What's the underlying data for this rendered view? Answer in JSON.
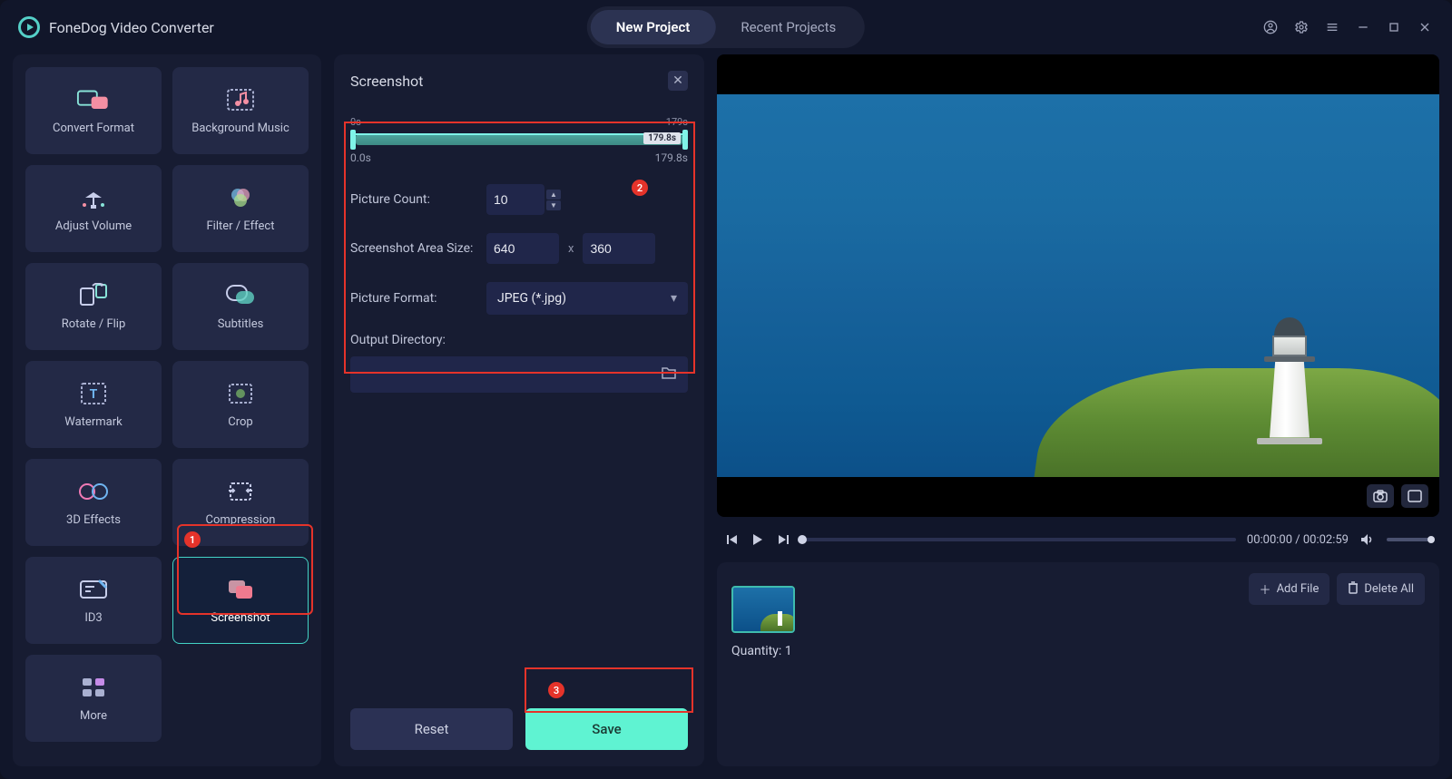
{
  "app": {
    "title": "FoneDog Video Converter"
  },
  "header": {
    "tabs": [
      {
        "label": "New Project",
        "active": true
      },
      {
        "label": "Recent Projects",
        "active": false
      }
    ]
  },
  "sidebar": {
    "tools": [
      {
        "id": "convert-format",
        "label": "Convert Format"
      },
      {
        "id": "background-music",
        "label": "Background Music"
      },
      {
        "id": "adjust-volume",
        "label": "Adjust Volume"
      },
      {
        "id": "filter-effect",
        "label": "Filter / Effect"
      },
      {
        "id": "rotate-flip",
        "label": "Rotate / Flip"
      },
      {
        "id": "subtitles",
        "label": "Subtitles"
      },
      {
        "id": "watermark",
        "label": "Watermark"
      },
      {
        "id": "crop",
        "label": "Crop"
      },
      {
        "id": "3d-effects",
        "label": "3D Effects"
      },
      {
        "id": "compression",
        "label": "Compression"
      },
      {
        "id": "id3",
        "label": "ID3"
      },
      {
        "id": "screenshot",
        "label": "Screenshot",
        "selected": true
      },
      {
        "id": "more",
        "label": "More"
      }
    ]
  },
  "settings": {
    "title": "Screenshot",
    "timeline": {
      "start_label": "0s",
      "end_label": "179s",
      "under_start": "0.0s",
      "under_end": "179.8s",
      "badge": "179.8s"
    },
    "picture_count": {
      "label": "Picture Count:",
      "value": "10"
    },
    "area_size": {
      "label": "Screenshot Area Size:",
      "width": "640",
      "height": "360",
      "multiply": "x"
    },
    "picture_format": {
      "label": "Picture Format:",
      "value": "JPEG (*.jpg)"
    },
    "output_dir": {
      "label": "Output Directory:",
      "value": ""
    },
    "buttons": {
      "reset": "Reset",
      "save": "Save"
    }
  },
  "preview": {
    "time": "00:00:00 / 00:02:59"
  },
  "assets": {
    "add_file": "Add File",
    "delete_all": "Delete All",
    "quantity_label": "Quantity: 1"
  },
  "markers": {
    "m1": "1",
    "m2": "2",
    "m3": "3"
  }
}
